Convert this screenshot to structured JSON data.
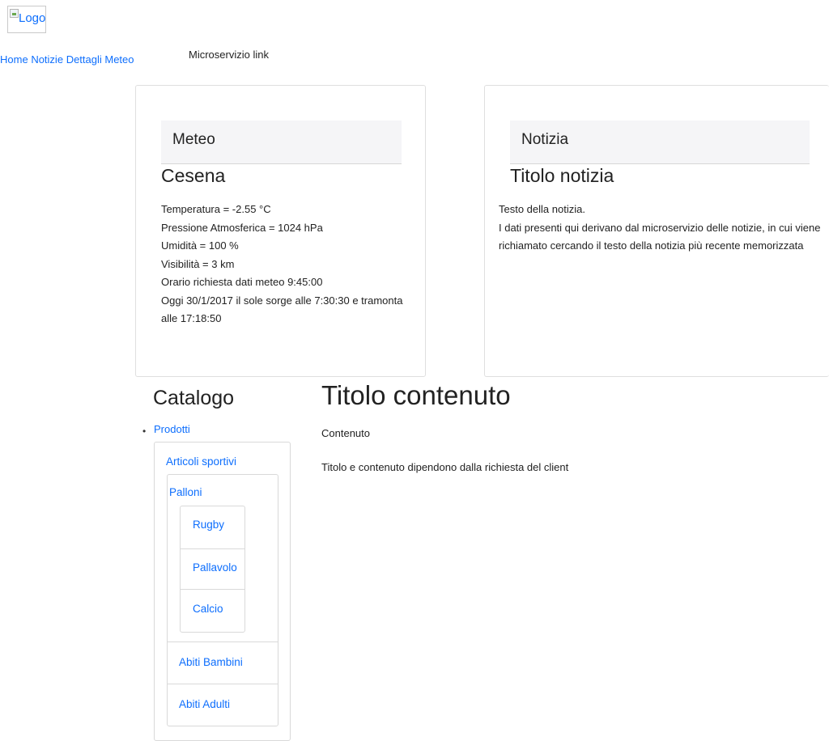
{
  "header": {
    "logo_alt": "Logo"
  },
  "nav": {
    "items": [
      {
        "label": "Home"
      },
      {
        "label": "Notizie"
      },
      {
        "label": "Dettagli Meteo"
      },
      {
        "label": "Microservizio link"
      }
    ]
  },
  "meteo": {
    "header": "Meteo",
    "city": "Cesena",
    "lines": [
      "Temperatura = -2.55 °C",
      "Pressione Atmosferica = 1024 hPa",
      "Umidità = 100 %",
      "Visibilità = 3 km",
      "Orario richiesta dati meteo 9:45:00",
      "Oggi 30/1/2017 il sole sorge alle 7:30:30 e tramonta",
      "alle 17:18:50"
    ]
  },
  "notizia": {
    "header": "Notizia",
    "title": "Titolo notizia",
    "lines": [
      "Testo della notizia.",
      "I dati presenti qui derivano dal microservizio delle notizie, in cui viene",
      "richiamato cercando il testo della notizia più recente memorizzata"
    ]
  },
  "catalog": {
    "title": "Catalogo",
    "root": "Prodotti",
    "articoli": "Articoli sportivi",
    "palloni": "Palloni",
    "balls": [
      "Rugby",
      "Pallavolo",
      "Calcio"
    ],
    "abiti_bambini": "Abiti Bambini",
    "abiti_adulti": "Abiti Adulti"
  },
  "content": {
    "title": "Titolo contenuto",
    "subtitle": "Contenuto",
    "text": "Titolo e contenuto dipendono dalla richiesta del client"
  }
}
